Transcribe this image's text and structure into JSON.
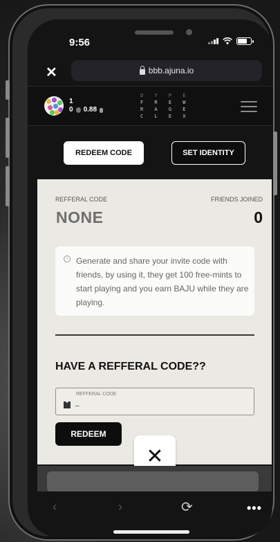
{
  "status_bar": {
    "time": "9:56",
    "battery_level": 0.75
  },
  "browser": {
    "close_label": "✕",
    "url": "bbb.ajuna.io"
  },
  "header": {
    "stat_line1": "1",
    "stat_value1": "0",
    "stat_value2": "0.88",
    "logo_rows": [
      "D Y P E",
      "F R E W",
      "R A G E",
      "C L E X"
    ]
  },
  "tabs": {
    "redeem_label": "REDEEM CODE",
    "identity_label": "SET IDENTITY"
  },
  "card": {
    "referral_label": "REFFERAL CODE",
    "friends_label": "FRIENDS JOINED",
    "referral_value": "NONE",
    "friends_value": "0",
    "info_text": "Generate and share your invite code with friends, by using it, they get 100 free-mints to start playing and you earn BAJU while they are playing.",
    "have_title": "HAVE A REFFERAL CODE??",
    "input_label": "REFFERAL CODE",
    "input_value": "–",
    "redeem_button": "REDEEM"
  },
  "modal": {
    "close_label": "✕"
  },
  "nav": {
    "back": "‹",
    "forward": "›",
    "reload": "⟳",
    "more": "•••"
  },
  "colors": {
    "card_bg": "#ebe9e3",
    "accent_dark": "#0d0d0d",
    "white": "#ffffff"
  }
}
